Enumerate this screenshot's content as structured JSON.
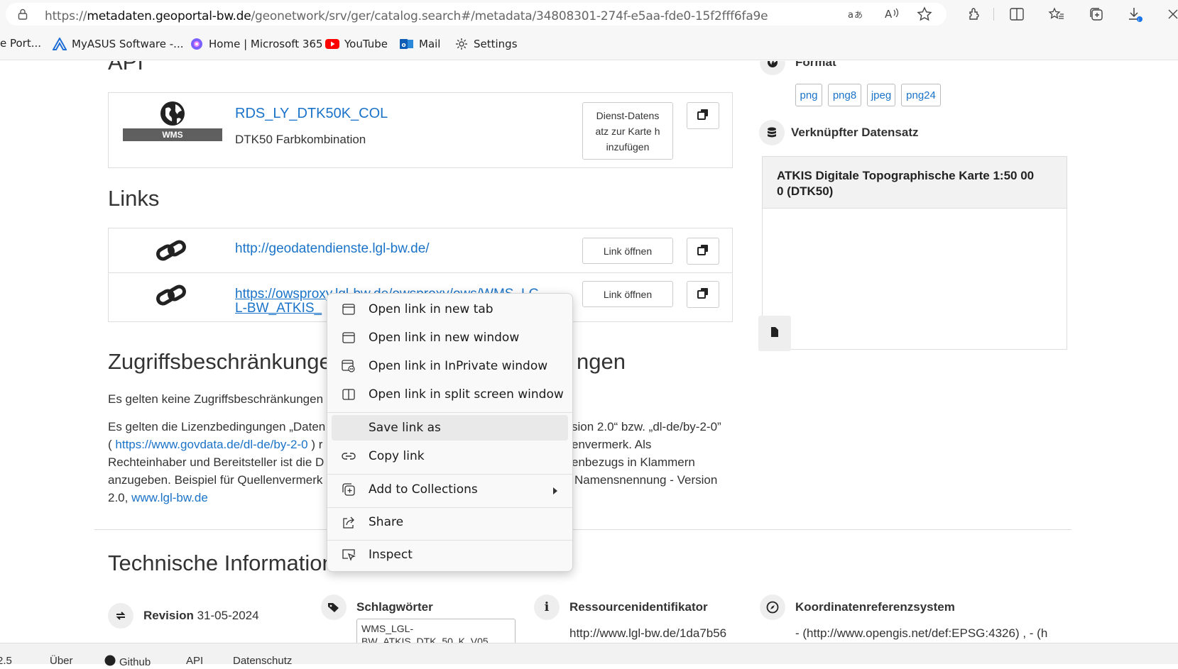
{
  "browser": {
    "url_prefix": "https://",
    "url_domain": "metadaten.geoportal-bw.de",
    "url_path": "/geonetwork/srv/ger/catalog.search#/metadata/34808301-274f-e5aa-fde0-15f2fff6fa9e",
    "icons": [
      "info-lock-icon",
      "translate-icon",
      "read-aloud-icon",
      "favorite-star-icon",
      "extensions-icon",
      "split-screen-icon",
      "favorites-icon",
      "collections-icon",
      "downloads-icon"
    ]
  },
  "favorites": {
    "items": [
      {
        "label": "e Port..."
      },
      {
        "label": "MyASUS Software -..."
      },
      {
        "label": "Home | Microsoft 365"
      },
      {
        "label": "YouTube"
      },
      {
        "label": "Mail"
      },
      {
        "label": "Settings"
      }
    ]
  },
  "api": {
    "heading": "API",
    "service_badge": "WMS",
    "service_title": "RDS_LY_DTK50K_COL",
    "service_desc": "DTK50 Farbkombination",
    "add_button": "Dienst-Datens atz zur Karte h inzufügen",
    "add_button_lines": [
      "Dienst-Datens",
      "atz zur Karte h",
      "inzufügen"
    ]
  },
  "links": {
    "heading": "Links",
    "items": [
      {
        "url": "http://geodatendienste.lgl-bw.de/",
        "button": "Link öffnen"
      },
      {
        "url_line1": "https://owsproxy.lgl-bw.de/owsproxy/ows/WMS_LG",
        "url_line2": "L-BW_ATKIS_",
        "button": "Link öffnen"
      }
    ]
  },
  "constraints": {
    "heading_left": "Zugriffsbeschränkungen",
    "heading_right": "ngen",
    "link_text": "Es gelten keine Zugriffsbeschränkungen",
    "para": {
      "l1a": "Es gelten die Lizenzbedingungen „Daten",
      "l1b": "sion 2.0“ bzw. „dl-de/by-2-0”",
      "l2_link": "https://www.govdata.de/dl-de/by-2-0",
      "l2a": "( ",
      "l2b": " ) r",
      "l2c": "envermerk. Als",
      "l3a": "Rechteinhaber und Bereitsteller ist die D",
      "l3b": "enbezugs in Klammern",
      "l4a": "anzugeben. Beispiel für Quellenvermerk",
      "l4b": "Namensnennung - Version",
      "l5a": "2.0, ",
      "l5_link": "www.lgl-bw.de"
    }
  },
  "tech": {
    "heading": "Technische Information",
    "revision_label": "Revision",
    "revision_value": "31-05-2024",
    "keywords_label": "Schlagwörter",
    "keywords_value_line1": "WMS_LGL-",
    "keywords_value_line2": "BW_ATKIS_DTK_50_K_V05",
    "resource_label": "Ressourcenidentifikator",
    "resource_value": "http://www.lgl-bw.de/1da7b56",
    "crs_label": "Koordinatenreferenzsystem",
    "crs_value": "- (http://www.opengis.net/def:EPSG:4326) , - (h"
  },
  "sidebar": {
    "format_title": "Format",
    "formats": [
      "png",
      "png8",
      "jpeg",
      "png24"
    ],
    "linked_title": "Verknüpfter Datensatz",
    "linked_dataset_line1": "ATKIS Digitale Topographische Karte 1:50 00",
    "linked_dataset_line2": "0 (DTK50)"
  },
  "context_menu": {
    "items": [
      {
        "label": "Open link in new tab",
        "icon": "new-tab-icon"
      },
      {
        "label": "Open link in new window",
        "icon": "new-window-icon"
      },
      {
        "label": "Open link in InPrivate window",
        "icon": "inprivate-window-icon"
      },
      {
        "label": "Open link in split screen window",
        "icon": "split-screen-window-icon"
      },
      {
        "label": "Save link as",
        "icon": ""
      },
      {
        "label": "Copy link",
        "icon": "link-icon"
      },
      {
        "label": "Add to Collections",
        "icon": "collections-add-icon"
      },
      {
        "label": "Share",
        "icon": "share-icon"
      },
      {
        "label": "Inspect",
        "icon": "inspect-icon"
      }
    ]
  },
  "footer": {
    "items": [
      "2.5",
      "Über",
      "Github",
      "API",
      "Datenschutz"
    ]
  }
}
